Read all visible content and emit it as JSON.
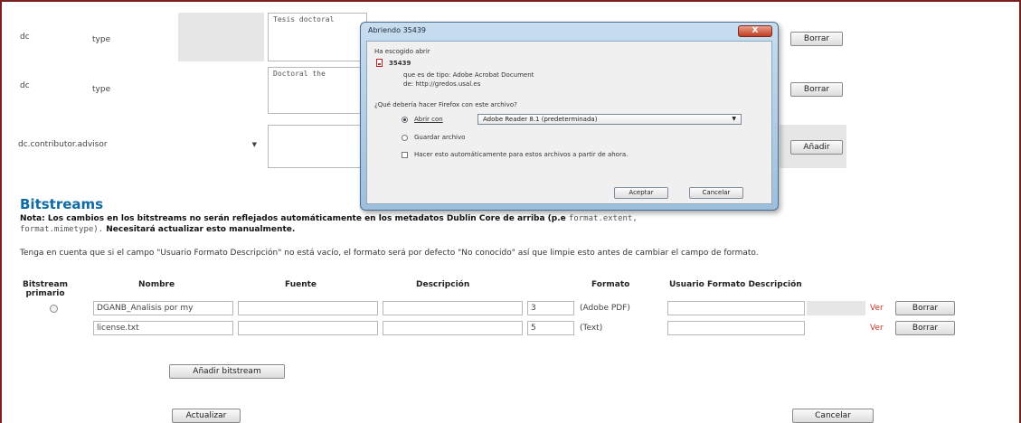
{
  "metadata_rows": [
    {
      "schema": "dc",
      "element": "type",
      "value": "Tesis doctoral",
      "remove_label": "Borrar"
    },
    {
      "schema": "dc",
      "element": "type",
      "value": "Doctoral the",
      "remove_label": "Borrar"
    }
  ],
  "add_field": {
    "selected": "dc.contributor.advisor",
    "add_label": "Añadir"
  },
  "bitstreams": {
    "title": "Bitstreams",
    "note_bold_1": "Nota: Los cambios en los bitstreams no serán reflejados automáticamente en los metadatos Dublin Core de arriba (p.e",
    "note_code_1": "format.extent,",
    "note_code_2": "format.mimetype).",
    "note_bold_2": "Necesitará actualizar esto manualmente.",
    "hint": "Tenga en cuenta que si el campo \"Usuario Formato Descripción\" no está vacío, el formato será por defecto \"No conocido\" así que limpie esto antes de cambiar el campo de formato.",
    "columns": {
      "primary": "Bitstream primario",
      "name": "Nombre",
      "source": "Fuente",
      "description": "Descripción",
      "format": "Formato",
      "user_format": "Usuario Formato Descripción"
    },
    "rows": [
      {
        "name": "DGANB_Analisis por my",
        "source": "",
        "description": "",
        "format_id": "3",
        "format_name": "(Adobe PDF)",
        "user_format": "",
        "view_label": "Ver",
        "remove_label": "Borrar"
      },
      {
        "name": "license.txt",
        "source": "",
        "description": "",
        "format_id": "5",
        "format_name": "(Text)",
        "user_format": "",
        "view_label": "Ver",
        "remove_label": "Borrar"
      }
    ],
    "add_bitstream_label": "Añadir bitstream"
  },
  "footer": {
    "update_label": "Actualizar",
    "cancel_label": "Cancelar"
  },
  "dialog": {
    "title": "Abriendo 35439",
    "close_label": "X",
    "chosen_open": "Ha escogido abrir",
    "file_name": "35439",
    "file_type": "que es de tipo: Adobe Acrobat Document",
    "file_from": "de: http://gredos.usal.es",
    "question": "¿Qué debería hacer Firefox con este archivo?",
    "open_with_label": "Abrir con",
    "open_with_app": "Adobe Reader 8.1 (predeterminada)",
    "save_label": "Guardar archivo",
    "auto_label": "Hacer esto automáticamente para estos archivos a partir de ahora.",
    "accept_label": "Aceptar",
    "cancel_label": "Cancelar"
  },
  "colors": {
    "frame_border": "#7a1f1f",
    "bitstreams_title": "#0f6aa5",
    "view_link": "#c0392b"
  }
}
